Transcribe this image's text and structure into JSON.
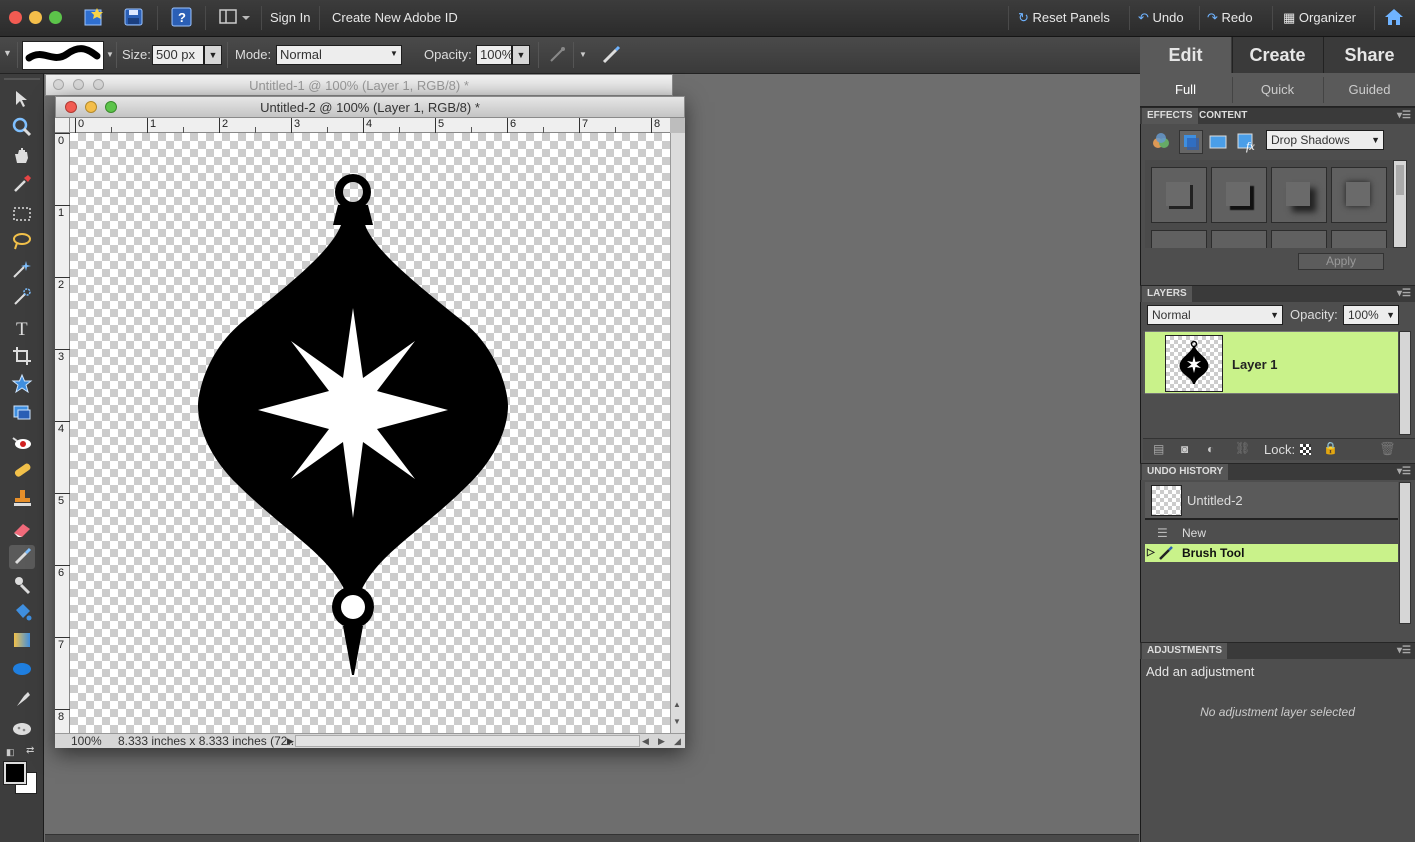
{
  "app": {
    "menubar": {
      "sign_in": "Sign In",
      "create_id": "Create New Adobe ID",
      "reset_panels": "Reset Panels",
      "undo": "Undo",
      "redo": "Redo",
      "organizer": "Organizer"
    },
    "options": {
      "size_label": "Size:",
      "size_value": "500 px",
      "mode_label": "Mode:",
      "mode_value": "Normal",
      "opacity_label": "Opacity:",
      "opacity_value": "100%"
    },
    "tools": [
      "move-tool",
      "zoom-tool",
      "hand-tool",
      "eyedropper-tool",
      "marquee-tool",
      "lasso-tool",
      "magic-wand-tool",
      "quick-selection-tool",
      "type-tool",
      "crop-tool",
      "cookie-cutter-tool",
      "straighten-tool",
      "red-eye-tool",
      "healing-brush-tool",
      "clone-stamp-tool",
      "eraser-tool",
      "brush-tool",
      "smart-brush-tool",
      "paint-bucket-tool",
      "gradient-tool",
      "shape-tool",
      "blur-tool",
      "sponge-tool"
    ]
  },
  "documents": {
    "doc1_title": "Untitled-1 @ 100% (Layer 1, RGB/8) *",
    "doc2_title": "Untitled-2 @ 100% (Layer 1, RGB/8) *",
    "ruler_h": [
      "0",
      "1",
      "2",
      "3",
      "4",
      "5",
      "6",
      "7",
      "8"
    ],
    "ruler_v": [
      "0",
      "1",
      "2",
      "3",
      "4",
      "5",
      "6",
      "7",
      "8"
    ],
    "zoom": "100%",
    "doc_info": "8.333 inches x 8.333 inches (72..."
  },
  "panel": {
    "tabs": [
      "Edit",
      "Create",
      "Share"
    ],
    "subtabs": [
      "Full",
      "Quick",
      "Guided"
    ],
    "effects": {
      "tab_effects": "EFFECTS",
      "tab_content": "CONTENT",
      "category": "Drop Shadows",
      "apply": "Apply"
    },
    "layers": {
      "header": "LAYERS",
      "blend_mode": "Normal",
      "opacity_label": "Opacity:",
      "opacity_value": "100%",
      "layer_name": "Layer 1",
      "lock_label": "Lock:"
    },
    "history": {
      "header": "UNDO HISTORY",
      "snapshot": "Untitled-2",
      "items": [
        "New",
        "Brush Tool"
      ]
    },
    "adjustments": {
      "header": "ADJUSTMENTS",
      "add": "Add an adjustment",
      "empty": "No adjustment layer selected"
    }
  },
  "colors": {
    "accent_green": "#c9f28a",
    "foreground": "#000000",
    "background": "#ffffff"
  }
}
